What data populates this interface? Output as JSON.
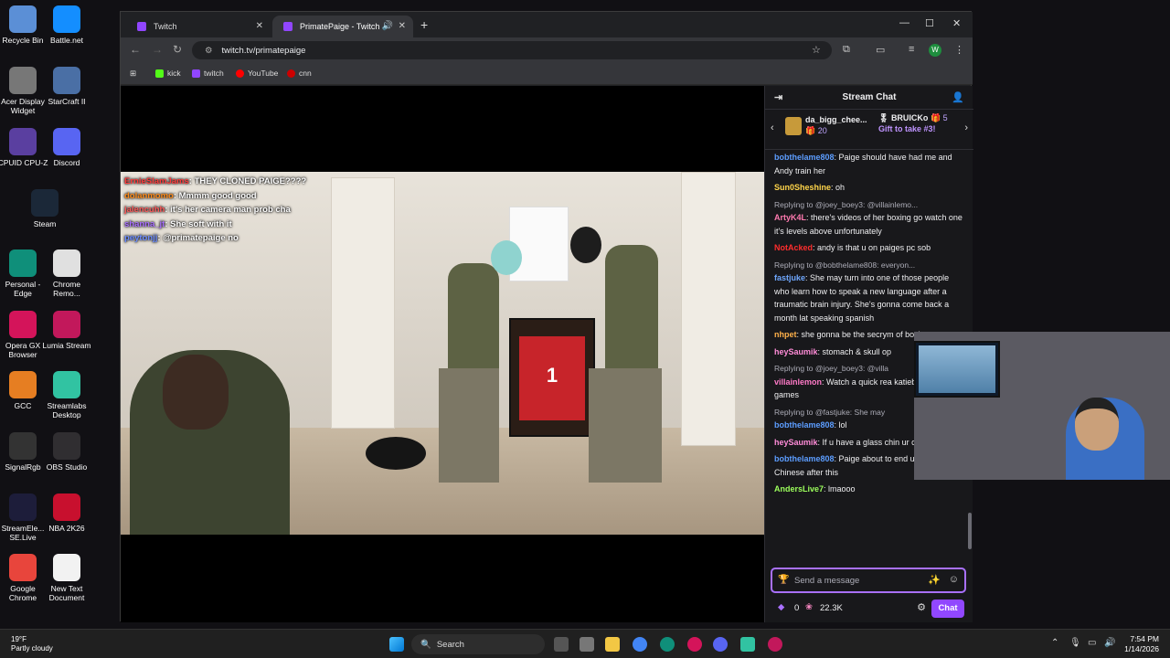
{
  "desktop": {
    "icons": [
      {
        "label": "Recycle Bin",
        "icon": "recycle-bin-icon",
        "color": "#5b8fd6"
      },
      {
        "label": "Battle.net",
        "icon": "battlenet-icon",
        "color": "#148eff"
      },
      {
        "label": "Acer Display Widget",
        "icon": "acer-icon",
        "color": "#777777"
      },
      {
        "label": "StarCraft II",
        "icon": "starcraft-icon",
        "color": "#4a6fa5"
      },
      {
        "label": "CPUID CPU-Z",
        "icon": "cpuz-icon",
        "color": "#5a3fa0"
      },
      {
        "label": "Discord",
        "icon": "discord-icon",
        "color": "#5865f2"
      },
      {
        "label": "Steam",
        "icon": "steam-icon",
        "color": "#1b2838"
      },
      {
        "label": "Personal - Edge",
        "icon": "edge-icon",
        "color": "#0f8f7a"
      },
      {
        "label": "Chrome Remo...",
        "icon": "chrome-remote-icon",
        "color": "#e0e0e0"
      },
      {
        "label": "Opera GX Browser",
        "icon": "opera-icon",
        "color": "#d4145a"
      },
      {
        "label": "Lumia Stream",
        "icon": "lumia-icon",
        "color": "#c2185b"
      },
      {
        "label": "GCC",
        "icon": "gcc-icon",
        "color": "#e67e22"
      },
      {
        "label": "Streamlabs Desktop",
        "icon": "streamlabs-icon",
        "color": "#31c3a2"
      },
      {
        "label": "SignalRgb",
        "icon": "signalrgb-icon",
        "color": "#333333"
      },
      {
        "label": "OBS Studio",
        "icon": "obs-icon",
        "color": "#302e31"
      },
      {
        "label": "StreamEle... SE.Live",
        "icon": "streamelements-icon",
        "color": "#1d1d3a"
      },
      {
        "label": "NBA 2K26",
        "icon": "nba2k-icon",
        "color": "#c8102e"
      },
      {
        "label": "Google Chrome",
        "icon": "chrome-icon",
        "color": "#e8453c"
      },
      {
        "label": "New Text Document",
        "icon": "text-document-icon",
        "color": "#f2f2f2"
      }
    ]
  },
  "browser": {
    "tabs": [
      {
        "label": "Twitch"
      },
      {
        "label": "PrimatePaige - Twitch"
      }
    ],
    "url": "twitch.tv/primatepaige",
    "bookmarks": [
      {
        "label": "kick",
        "color": "#53fc18"
      },
      {
        "label": "twitch",
        "color": "#9146ff"
      },
      {
        "label": "YouTube",
        "color": "#ff0000"
      },
      {
        "label": "cnn",
        "color": "#cc0000"
      }
    ],
    "profile_initial": "W"
  },
  "stream": {
    "overlay_chat": [
      {
        "user": "ErnieSlamJams",
        "user_color": "#ff3b3b",
        "text": ": THEY CLONED PAIGE????"
      },
      {
        "user": "dolanmomo",
        "user_color": "#ff8c1a",
        "text": ": Mmmm good good"
      },
      {
        "user": "jalencuhh",
        "user_color": "#ff5a5a",
        "text": ": it's her camera man prob cha"
      },
      {
        "user": "shanna_jt",
        "user_color": "#a970ff",
        "text": ": She soft with it"
      },
      {
        "user": "peytonjj",
        "user_color": "#6b8cff",
        "text": ": @primatepaige no"
      }
    ],
    "jersey_number": "1"
  },
  "chat": {
    "title": "Stream Chat",
    "gifts": {
      "left_user": "da_bigg_chee...",
      "left_count": "20",
      "right_user": "BRUICKo",
      "right_count": "5",
      "right_cta": "Gift to take #3!"
    },
    "messages": [
      {
        "reply": "",
        "user": "bobthelame808",
        "color": "#5c9dff",
        "text": ": Paige should have had me and Andy train her"
      },
      {
        "reply": "",
        "user": "Sun0Sheshine",
        "color": "#ffd54a",
        "text": ": oh"
      },
      {
        "reply": "Replying to @joey_boey3: @villainlemo...",
        "user": "ArtyK4L",
        "color": "#ff7ab0",
        "text": ": there's videos of her boxing go watch one it's levels above unfortunately"
      },
      {
        "reply": "",
        "user": "NotAcked",
        "color": "#ff2d2d",
        "text": ": andy is that u on paiges pc sob"
      },
      {
        "reply": "Replying to @bobthelame808: everyon...",
        "user": "fastjuke",
        "color": "#6fa8ff",
        "text": ": She may turn into one of those people who learn how to speak a new language after a traumatic brain injury. She's gonna come back a month lat speaking spanish"
      },
      {
        "reply": "",
        "user": "nhpet",
        "color": "#ffb14a",
        "text": ": she gonna be the secrym of boxing"
      },
      {
        "reply": "",
        "user": "heySaumik",
        "color": "#ff8cd8",
        "text": ": stomach & skull op"
      },
      {
        "reply": "Replying to @joey_boey3: @villa",
        "user": "villainlemon",
        "color": "#ff7ac8",
        "text": ": Watch a quick rea katieb at streamer games"
      },
      {
        "reply": "Replying to @fastjuke: She may",
        "user": "bobthelame808",
        "color": "#5c9dff",
        "text": ": lol"
      },
      {
        "reply": "",
        "user": "heySaumik",
        "color": "#ff8cd8",
        "text": ": If u have a glass chin ur cooked"
      },
      {
        "reply": "",
        "user": "bobthelame808",
        "color": "#5c9dff",
        "text": ": Paige about to end up speaking Chinese after this"
      },
      {
        "reply": "",
        "user": "AndersLive7",
        "color": "#9cff5c",
        "text": ": lmaooo"
      }
    ],
    "input_placeholder": "Send a message",
    "points": "0",
    "channel_points": "22.3K",
    "send_label": "Chat"
  },
  "taskbar": {
    "temperature": "19°F",
    "weather": "Partly cloudy",
    "search_label": "Search",
    "time": "7:54 PM",
    "date": "1/14/2026"
  }
}
